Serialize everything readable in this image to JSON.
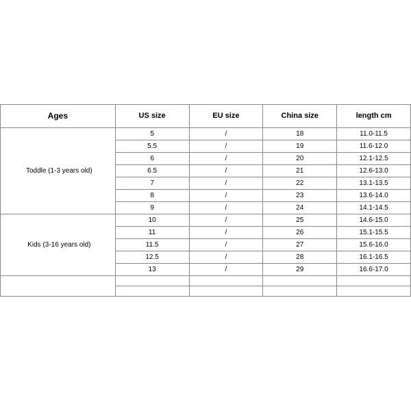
{
  "chart_data": {
    "type": "table",
    "headers": {
      "ages": "Ages",
      "us": "US size",
      "eu": "EU size",
      "china": "China size",
      "length": "length   cm"
    },
    "groups": [
      {
        "label": "Toddle (1-3 years old)",
        "rows": [
          {
            "us": "5",
            "eu": "/",
            "china": "18",
            "length": "11.0-11.5"
          },
          {
            "us": "5.5",
            "eu": "/",
            "china": "19",
            "length": "11.6-12.0"
          },
          {
            "us": "6",
            "eu": "/",
            "china": "20",
            "length": "12.1-12.5"
          },
          {
            "us": "6.5",
            "eu": "/",
            "china": "21",
            "length": "12.6-13.0"
          },
          {
            "us": "7",
            "eu": "/",
            "china": "22",
            "length": "13.1-13.5"
          },
          {
            "us": "8",
            "eu": "/",
            "china": "23",
            "length": "13.6-14.0"
          },
          {
            "us": "9",
            "eu": "/",
            "china": "24",
            "length": "14.1-14.5"
          }
        ]
      },
      {
        "label": "Kids (3-16 years old)",
        "rows": [
          {
            "us": "10",
            "eu": "/",
            "china": "25",
            "length": "14.6-15.0"
          },
          {
            "us": "11",
            "eu": "/",
            "china": "26",
            "length": "15.1-15.5"
          },
          {
            "us": "11.5",
            "eu": "/",
            "china": "27",
            "length": "15.6-16.0"
          },
          {
            "us": "12.5",
            "eu": "/",
            "china": "28",
            "length": "16.1-16.5"
          },
          {
            "us": "13",
            "eu": "/",
            "china": "29",
            "length": "16.6-17.0"
          }
        ]
      },
      {
        "label": "",
        "rows": [
          {
            "us": "",
            "eu": "",
            "china": "",
            "length": ""
          },
          {
            "us": "",
            "eu": "",
            "china": "",
            "length": ""
          }
        ]
      }
    ]
  }
}
